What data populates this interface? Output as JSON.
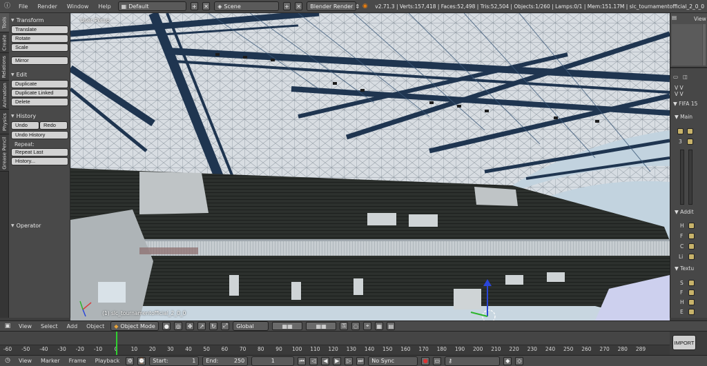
{
  "topbar": {
    "menus": [
      "File",
      "Render",
      "Window",
      "Help"
    ],
    "layout": "Default",
    "scene": "Scene",
    "engine": "Blender Render",
    "stats": "v2.71.3 | Verts:157,418 | Faces:52,498 | Tris:52,504 | Objects:1/260 | Lamps:0/1 | Mem:151.17M | slc_tournamentofficial_2_0_0"
  },
  "vtabs": [
    "Tools",
    "Create",
    "Relations",
    "Animation",
    "Physics",
    "Grease Pencil"
  ],
  "toolshelf": {
    "transform": {
      "title": "Transform",
      "buttons": [
        "Translate",
        "Rotate",
        "Scale",
        "Mirror"
      ]
    },
    "edit": {
      "title": "Edit",
      "buttons": [
        "Duplicate",
        "Duplicate Linked",
        "Delete"
      ]
    },
    "history": {
      "title": "History",
      "undo": "Undo",
      "redo": "Redo",
      "undo_history": "Undo History",
      "repeat_label": "Repeat:",
      "repeat_last": "Repeat Last",
      "history": "History..."
    },
    "operator": {
      "title": "Operator"
    }
  },
  "viewport": {
    "view_label": "User Persp",
    "object_label": "(1) slc_tournamentofficial_2_0_0"
  },
  "right_panel": {
    "view": "View",
    "vv1": "V V",
    "vv2": "V V",
    "fifa": "FIFA 15",
    "main": "Main",
    "num3": "3",
    "addit": "Addit",
    "letters1": [
      "H",
      "F",
      "C",
      "Li"
    ],
    "textu": "Textu",
    "letters2": [
      "S",
      "F",
      "H",
      "E"
    ],
    "import": "IMPORT"
  },
  "view3d_header": {
    "menus": [
      "View",
      "Select",
      "Add",
      "Object"
    ],
    "mode": "Object Mode",
    "orientation": "Global"
  },
  "timeline": {
    "ticks": [
      "-60",
      "-50",
      "-40",
      "-30",
      "-20",
      "-10",
      "0",
      "10",
      "20",
      "30",
      "40",
      "50",
      "60",
      "70",
      "80",
      "90",
      "100",
      "110",
      "120",
      "130",
      "140",
      "150",
      "160",
      "170",
      "180",
      "190",
      "200",
      "210",
      "220",
      "230",
      "240",
      "250",
      "260",
      "270",
      "280",
      "289"
    ],
    "current_frame": 0
  },
  "timeline_header": {
    "menus": [
      "View",
      "Marker",
      "Frame",
      "Playback"
    ],
    "start": "Start:",
    "start_val": "1",
    "end": "End:",
    "end_val": "250",
    "frame": "1",
    "sync": "No Sync"
  }
}
